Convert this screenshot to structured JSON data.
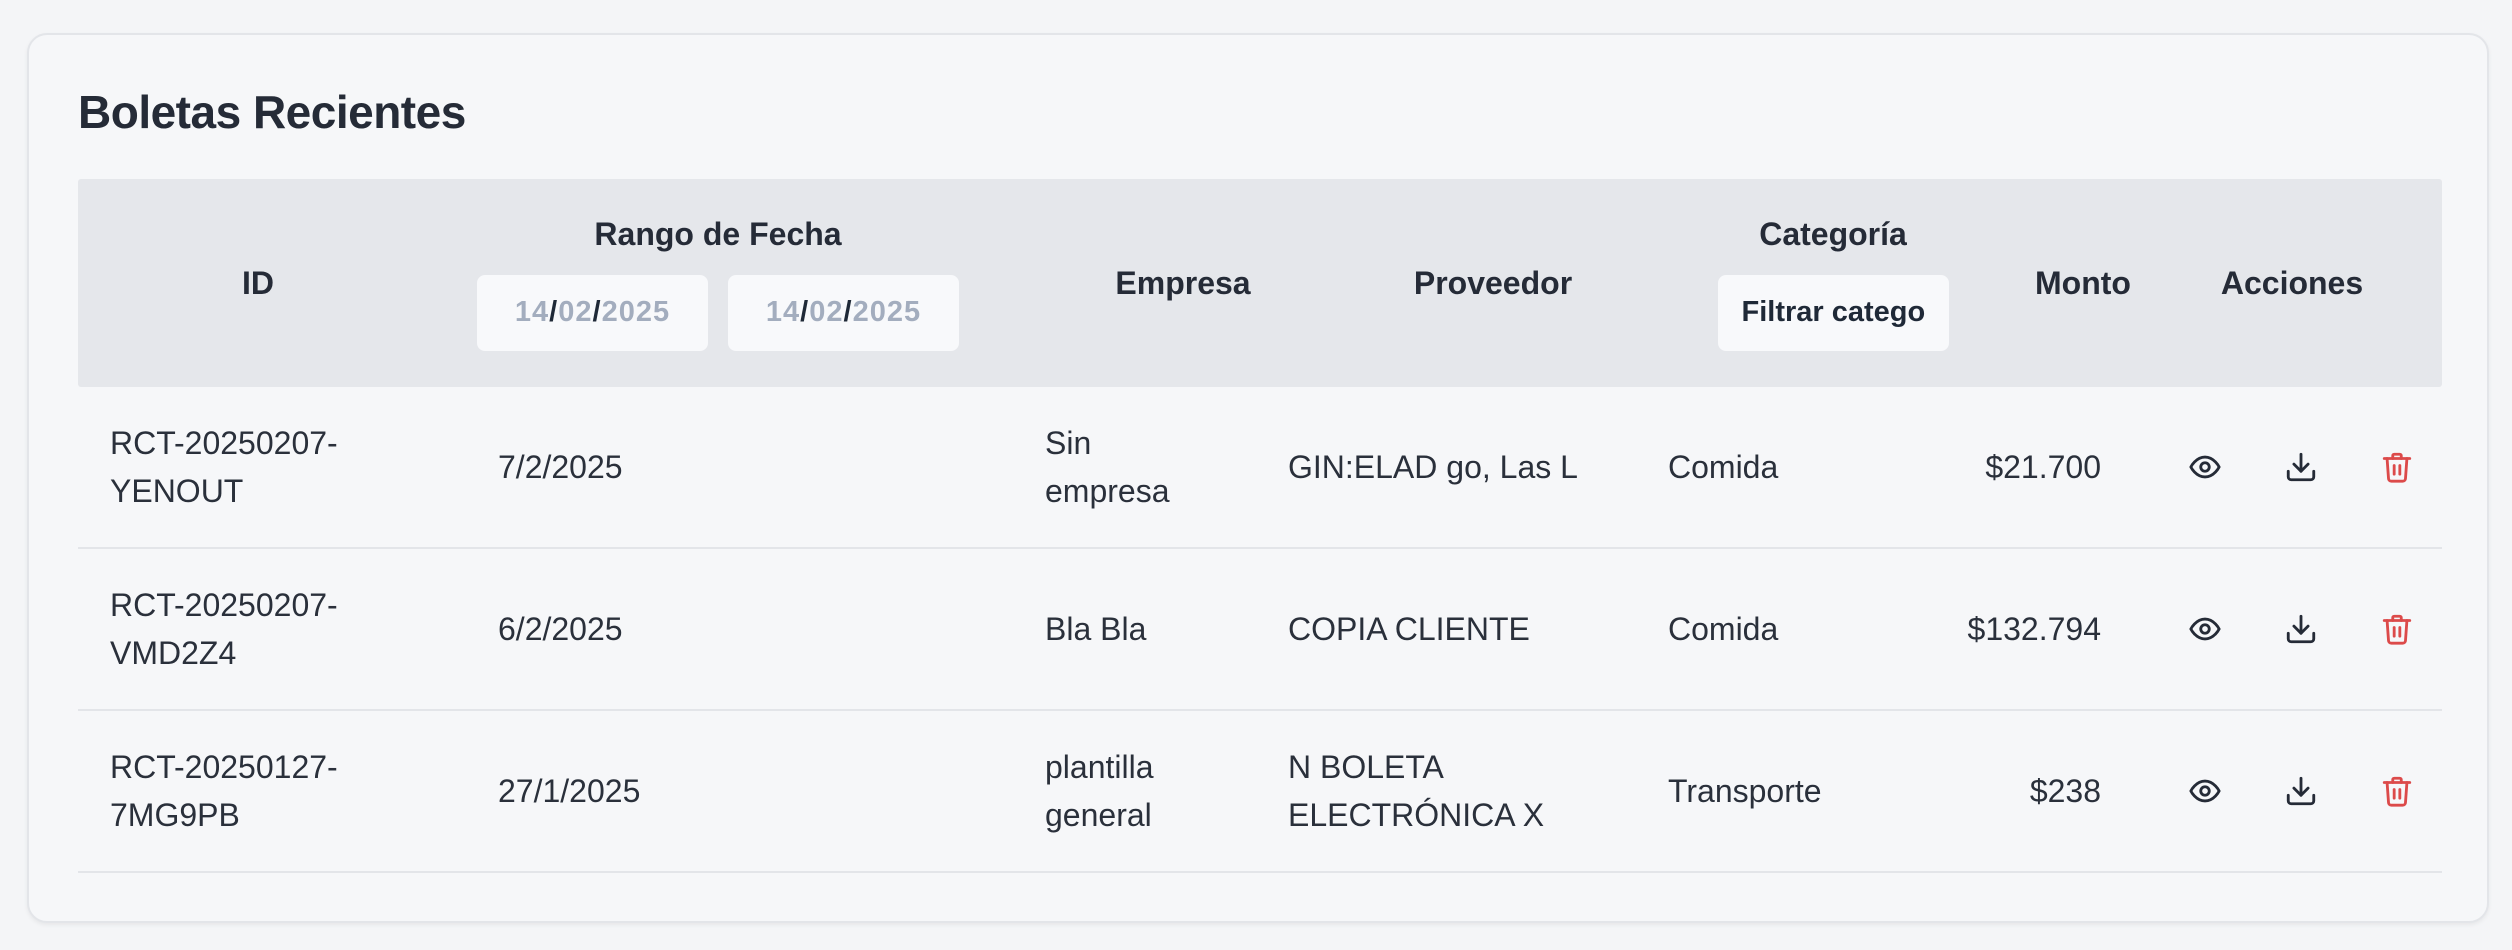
{
  "card": {
    "title": "Boletas Recientes"
  },
  "table": {
    "headers": {
      "id": "ID",
      "date_range": "Rango de Fecha",
      "company": "Empresa",
      "provider": "Proveedor",
      "category": "Categoría",
      "amount": "Monto",
      "actions": "Acciones"
    },
    "date_from": {
      "day": "14",
      "month": "02",
      "year": "2025",
      "sep": "/"
    },
    "date_to": {
      "day": "14",
      "month": "02",
      "year": "2025",
      "sep": "/"
    },
    "category_filter": {
      "value": "Filtrar catego"
    },
    "rows": [
      {
        "id": "RCT-20250207-YENOUT",
        "date": "7/2/2025",
        "company": "Sin empresa",
        "provider": "GIN:ELAD go, Las L",
        "category": "Comida",
        "amount": "$21.700"
      },
      {
        "id": "RCT-20250207-VMD2Z4",
        "date": "6/2/2025",
        "company": "Bla Bla",
        "provider": "COPIA CLIENTE",
        "category": "Comida",
        "amount": "$132.794"
      },
      {
        "id": "RCT-20250127-7MG9PB",
        "date": "27/1/2025",
        "company": "plantilla general",
        "provider": "N BOLETA ELECTRÓNICA X",
        "category": "Transporte",
        "amount": "$238"
      }
    ]
  },
  "icons": {
    "view": "eye-icon",
    "download": "download-icon",
    "delete": "trash-icon"
  },
  "colors": {
    "delete": "#dc4a4a",
    "icon": "#252b37",
    "header_bg": "#e5e7eb"
  }
}
